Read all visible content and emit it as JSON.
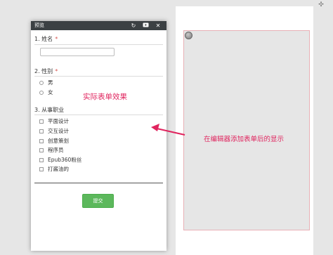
{
  "preview": {
    "title": "预览",
    "icons": [
      "refresh-icon",
      "play-icon",
      "close-icon"
    ],
    "questions": [
      {
        "label": "1. 姓名",
        "required": "*"
      },
      {
        "label": "2. 性别",
        "required": "*",
        "options": [
          "男",
          "女"
        ]
      },
      {
        "label": "3. 从事职业",
        "options": [
          "平面设计",
          "交互设计",
          "创意策划",
          "程序员",
          "Epub360粉丝",
          "打酱油的"
        ]
      }
    ],
    "submit_label": "提交"
  },
  "annotations": {
    "left": "实际表单效果",
    "right": "在编辑器添加表单后的显示"
  },
  "colors": {
    "header_bg": "#3b4043",
    "accent_red": "#e0245e",
    "required_red": "#d9534f",
    "submit_green": "#5cb85c"
  }
}
